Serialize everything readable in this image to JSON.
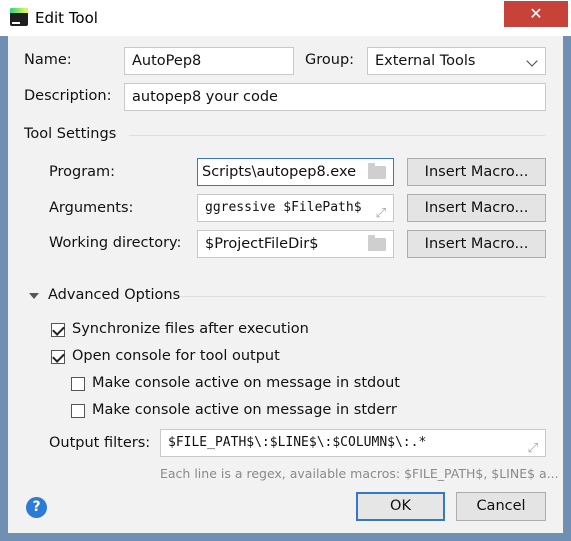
{
  "window": {
    "title": "Edit Tool",
    "close_label": "✕"
  },
  "form": {
    "name_label": "Name:",
    "name_value": "AutoPep8",
    "group_label": "Group:",
    "group_value": "External Tools",
    "description_label": "Description:",
    "description_value": "autopep8 your code"
  },
  "tool_settings": {
    "section_label": "Tool Settings",
    "program_label": "Program:",
    "program_value": "Scripts\\autopep8.exe",
    "arguments_label": "Arguments:",
    "arguments_value": "ggressive $FilePath$",
    "working_dir_label": "Working directory:",
    "working_dir_value": "$ProjectFileDir$",
    "insert_macro_label": "Insert Macro..."
  },
  "advanced": {
    "section_label": "Advanced Options",
    "sync_label": "Synchronize files after execution",
    "sync_checked": true,
    "console_label": "Open console for tool output",
    "console_checked": true,
    "active_stdout_label": "Make console active on message in stdout",
    "active_stdout_checked": false,
    "active_stderr_label": "Make console active on message in stderr",
    "active_stderr_checked": false,
    "output_filters_label": "Output filters:",
    "output_filters_value": "$FILE_PATH$\\:$LINE$\\:$COLUMN$\\:.*",
    "hint": "Each line is a regex, available macros: $FILE_PATH$, $LINE$ a..."
  },
  "footer": {
    "help_label": "?",
    "ok_label": "OK",
    "cancel_label": "Cancel"
  },
  "colors": {
    "frame": "#6f8fb3",
    "close_button": "#c7433a",
    "primary_border": "#3578c9",
    "help_icon": "#2d7bd6"
  }
}
